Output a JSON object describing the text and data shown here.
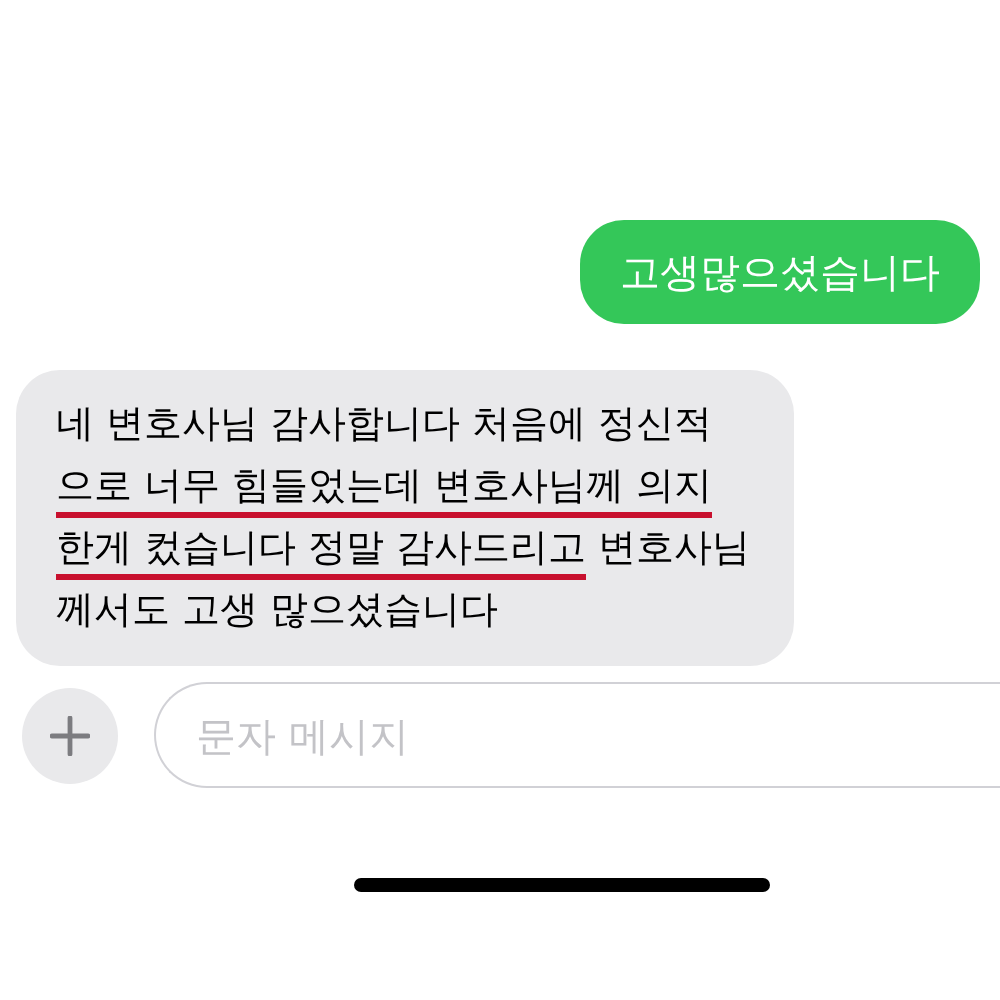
{
  "sent_message": {
    "text": "고생많으셨습니다"
  },
  "received_message": {
    "lines": [
      [
        {
          "text": "네 변호사님 감사합니다 처음에 정신적",
          "underlined": false
        }
      ],
      [
        {
          "text": "으로 너무 힘들었는데 변호사님께 의지",
          "underlined": true
        }
      ],
      [
        {
          "text": "한게 컸습니다 정말 감사드리고",
          "underlined": true
        },
        {
          "text": " 변호사님",
          "underlined": false
        }
      ],
      [
        {
          "text": "께서도 고생 많으셨습니다",
          "underlined": false
        }
      ]
    ]
  },
  "composer": {
    "placeholder": "문자 메시지"
  }
}
